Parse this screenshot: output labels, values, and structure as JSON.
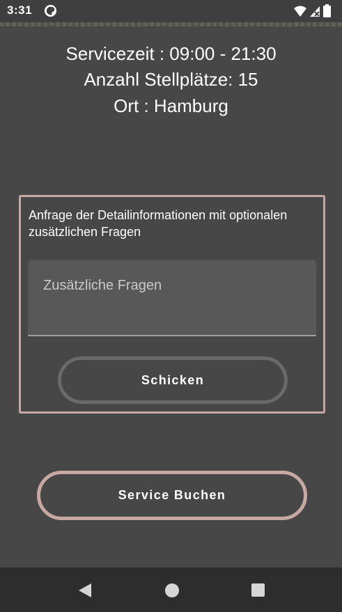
{
  "status_bar": {
    "time": "3:31",
    "icons": [
      "app-notification-icon",
      "wifi-icon",
      "cellular-signal-icon",
      "battery-icon"
    ]
  },
  "info": {
    "service_time": "Servicezeit : 09:00 - 21:30",
    "parking_count": "Anzahl Stellplätze: 15",
    "location": "Ort : Hamburg"
  },
  "request_card": {
    "description": "Anfrage der Detailinformationen mit optionalen zusätzlichen Fragen",
    "questions_placeholder": "Zusätzliche Fragen",
    "send_label": "Schicken"
  },
  "book_button_label": "Service Buchen",
  "colors": {
    "background": "#474747",
    "accent_border": "#c8a8a2",
    "send_border": "#6a6a6a",
    "nav_bar": "#2d2d2d"
  },
  "nav_bar": {
    "icons": [
      "back-icon",
      "home-icon",
      "recent-apps-icon"
    ]
  }
}
